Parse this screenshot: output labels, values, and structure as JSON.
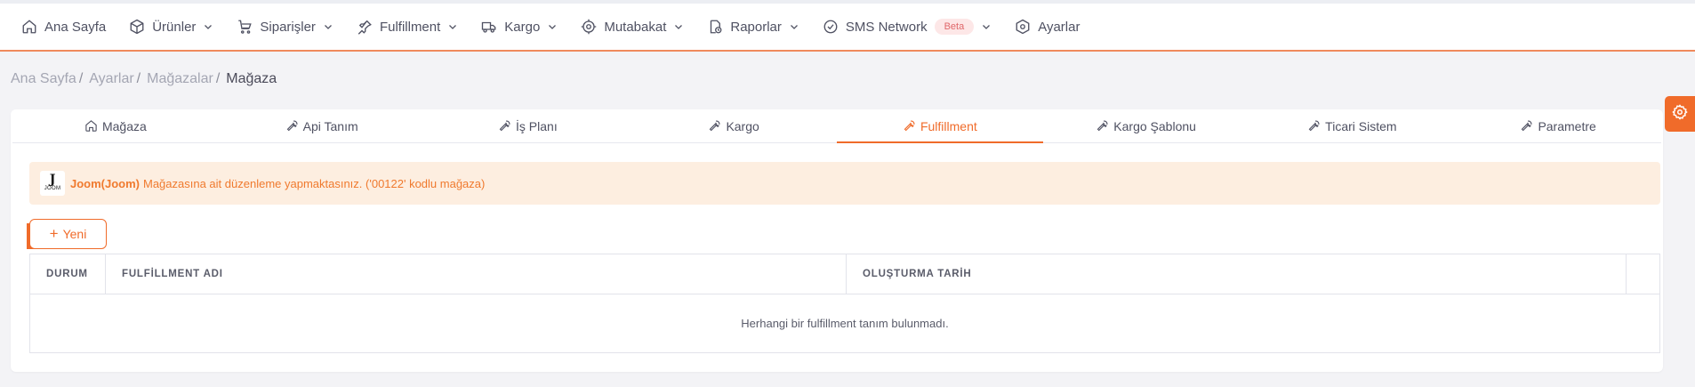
{
  "nav": {
    "items": [
      {
        "label": "Ana Sayfa",
        "icon": "home-icon",
        "dropdown": false
      },
      {
        "label": "Ürünler",
        "icon": "box-icon",
        "dropdown": true
      },
      {
        "label": "Siparişler",
        "icon": "cart-icon",
        "dropdown": true
      },
      {
        "label": "Fulfillment",
        "icon": "pin-icon",
        "dropdown": true
      },
      {
        "label": "Kargo",
        "icon": "truck-icon",
        "dropdown": true
      },
      {
        "label": "Mutabakat",
        "icon": "target-icon",
        "dropdown": true
      },
      {
        "label": "Raporlar",
        "icon": "report-icon",
        "dropdown": true
      },
      {
        "label": "SMS Network",
        "icon": "check-circle-icon",
        "dropdown": true,
        "badge": "Beta"
      },
      {
        "label": "Ayarlar",
        "icon": "hexagon-gear-icon",
        "dropdown": false
      }
    ]
  },
  "breadcrumb": {
    "items": [
      "Ana Sayfa",
      "Ayarlar",
      "Mağazalar"
    ],
    "separator": "/",
    "current": "Mağaza"
  },
  "tabs": [
    {
      "label": "Mağaza",
      "icon": "home-icon",
      "active": false
    },
    {
      "label": "Api Tanım",
      "icon": "wrench-icon",
      "active": false
    },
    {
      "label": "İş Planı",
      "icon": "wrench-icon",
      "active": false
    },
    {
      "label": "Kargo",
      "icon": "wrench-icon",
      "active": false
    },
    {
      "label": "Fulfillment",
      "icon": "wrench-icon",
      "active": true
    },
    {
      "label": "Kargo Şablonu",
      "icon": "wrench-icon",
      "active": false
    },
    {
      "label": "Ticari Sistem",
      "icon": "wrench-icon",
      "active": false
    },
    {
      "label": "Parametre",
      "icon": "wrench-icon",
      "active": false
    }
  ],
  "alert": {
    "logo_letter": "J",
    "logo_word": "JOOM",
    "store": "Joom(Joom)",
    "message": "Mağazasına ait düzenleme yapmaktasınız. ('00122' kodlu mağaza)"
  },
  "new_button": {
    "plus": "+",
    "label": "Yeni"
  },
  "table": {
    "columns": [
      "DURUM",
      "FULFİLLMENT ADI",
      "OLUŞTURMA TARİH",
      ""
    ],
    "empty_message": "Herhangi bir fulfillment tanım bulunmadı."
  },
  "colors": {
    "accent": "#f06b2a",
    "alert_bg": "#fdeee0",
    "beta_bg": "#fde7e7",
    "beta_text": "#e0676a"
  }
}
